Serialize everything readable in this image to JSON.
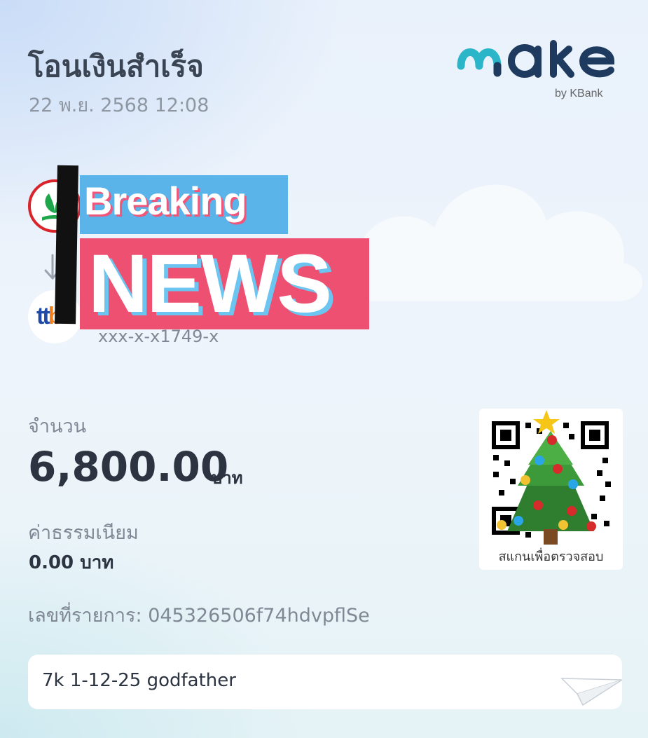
{
  "header": {
    "title": "โอนเงินสำเร็จ",
    "datetime": "22 พ.ย. 2568 12:08"
  },
  "brand": {
    "logo_word": "make",
    "by_text": "by KBank",
    "color_teal": "#2bb5c8",
    "color_navy": "#1f3a5f"
  },
  "transfer": {
    "from_bank_icon": "kbank-logo-icon",
    "to_bank_icon": "ttb-logo-icon",
    "to_bank_logo_text": "ttb",
    "to_account": "xxx-x-x1749-x"
  },
  "sticker": {
    "line1": "Breaking",
    "line2": "NEWS",
    "color_blue": "#5ab4ea",
    "color_pink": "#ee5072"
  },
  "amount": {
    "label": "จำนวน",
    "value": "6,800.00",
    "unit": "บาท"
  },
  "fee": {
    "label": "ค่าธรรมเนียม",
    "value": "0.00 บาท"
  },
  "reference": {
    "text": "เลขที่รายการ: 045326506f74hdvpflSe"
  },
  "qr": {
    "caption": "สแกนเพื่อตรวจสอบ",
    "overlay_icon": "christmas-tree-icon"
  },
  "memo": {
    "text": "7k 1-12-25 godfather",
    "icon": "paper-plane-icon"
  }
}
